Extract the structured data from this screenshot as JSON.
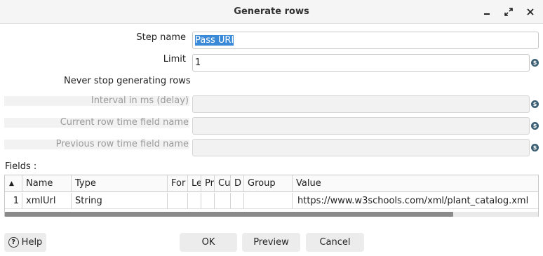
{
  "window": {
    "title": "Generate rows",
    "icons": [
      "minimize-icon",
      "maximize-icon",
      "close-icon"
    ]
  },
  "form": {
    "step_name_label": "Step name",
    "step_name_value": "Pass URI",
    "limit_label": "Limit",
    "limit_value": "1",
    "never_stop_label": "Never stop generating rows",
    "interval_label": "Interval in ms (delay)",
    "interval_value": "",
    "current_row_label": "Current row time field name",
    "current_row_value": "",
    "previous_row_label": "Previous row time field name",
    "previous_row_value": "",
    "variable_icon": "$"
  },
  "fields": {
    "label": "Fields :",
    "sort_indicator": "▲",
    "columns": [
      "Name",
      "Type",
      "Format",
      "Length",
      "Precision",
      "Currency",
      "Decimal",
      "Group",
      "Value"
    ],
    "columns_visible": [
      "Name",
      "Type",
      "For",
      "Le",
      "Pr",
      "Cu",
      "D",
      "Group",
      "Value"
    ],
    "rows": [
      {
        "num": "1",
        "name": "xmlUrl",
        "type": "String",
        "format": "",
        "length": "",
        "precision": "",
        "currency": "",
        "decimal": "",
        "group": "",
        "value": "https://www.w3schools.com/xml/plant_catalog.xml"
      }
    ]
  },
  "buttons": {
    "help": "Help",
    "ok": "OK",
    "preview": "Preview",
    "cancel": "Cancel"
  }
}
